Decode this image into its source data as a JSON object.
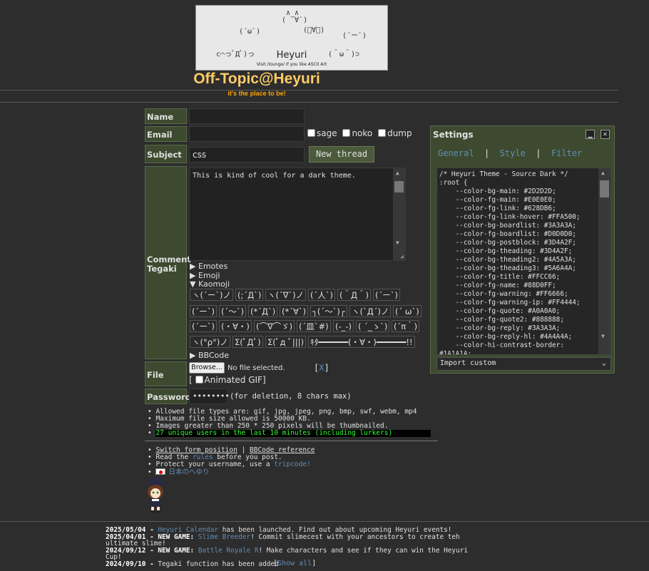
{
  "banner": {
    "title": "Heyuri",
    "subtitle": "Visit /lounge/ if you like ASCII Art"
  },
  "board": {
    "title": "Off-Topic@Heyuri",
    "subtitle": "it's the place to be!"
  },
  "form": {
    "name_label": "Name",
    "email_label": "Email",
    "subject_label": "Subject",
    "comment_label": "Comment",
    "tegaki_label": "Tegaki",
    "file_label": "File",
    "password_label": "Password",
    "subject_value": "css",
    "sage_label": "sage",
    "noko_label": "noko",
    "dump_label": "dump",
    "new_thread_button": "New thread",
    "comment_value": "This is kind of cool for a dark theme.",
    "emotes_label": "Emotes",
    "emoji_label": "Emoji",
    "kaomoji_label": "Kaomoji",
    "bbcode_label": "BBCode",
    "kaomoji": [
      [
        "ヽ(´ー`)ノ",
        "(;´Д`)",
        "ヽ(´∇`)ノ",
        "(´人`)",
        "(＾Д＾)",
        "(´ー`)"
      ],
      [
        "(´ー`)",
        "(´～`)",
        "(*´Д`)",
        "(*´∀`)",
        "┐(´～`)┌",
        "ヽ(`Д´)ノ",
        "(´ ω`)"
      ],
      [
        "(´ー`)",
        "(・∀・)",
        "(⌒∇⌒ゞ)",
        "(´皿`#)",
        "(-_-)",
        "( ´_ゝ`)",
        "(´π｀)"
      ],
      [
        "ヽ(°ρ°)ノ",
        "Σ(ﾟДﾟ)",
        "Σ(ﾟд ﾟ|||)",
        "ｷﾀ━━━━━━(・∀・)━━━━━━!!"
      ]
    ],
    "browse_button": "Browse...",
    "file_status": "No file selected.",
    "file_clear": "X",
    "animated_gif_label": "Animated GIF",
    "password_value": "••••••••",
    "password_hint": "(for deletion, 8 chars max)"
  },
  "rules": [
    "Allowed file types are: gif, jpg, jpeg, png, bmp, swf, webm, mp4",
    "Maximum file size allowed is 50000 KB.",
    "Images greater than 250 * 250 pixels will be thumbnailed."
  ],
  "users_online": "27 unique users in the last 10 minutes (including lurkers)",
  "links": {
    "switch_form": "Switch form position",
    "bbcode_ref": "BBCode reference",
    "rules_pre": "Read the ",
    "rules_link": "rules",
    "rules_post": " before you post.",
    "protect_pre": "Protect your username, use a ",
    "tripcode": "tripcode!",
    "japanese": "日本のへゆり"
  },
  "settings": {
    "title": "Settings",
    "tabs": [
      "General",
      "Style",
      "Filter"
    ],
    "code": [
      "/* Heyuri Theme - Source Dark */",
      ":root {",
      "    --color-bg-main: #2D2D2D;",
      "    --color-fg-main: #E0E0E0;",
      "    --color-fg-link: #628DB6;",
      "    --color-fg-link-hover: #FFA500;",
      "    --color-bg-boardlist: #3A3A3A;",
      "    --color-fg-boardlist: #D0D0D0;",
      "    --color-bg-postblock: #3D4A2F;",
      "    --color-bg-theading: #3D4A2F;",
      "    --color-bg-theading2: #4A5A3A;",
      "    --color-bg-theading3: #5A6A4A;",
      "    --color-fg-title: #FFCC66;",
      "    --color-fg-name: #88D0FF;",
      "    --color-fg-warning: #FF6666;",
      "    --color-fg-warning-ip: #FF4444;",
      "    --color-fg-quote: #A0A0A0;",
      "    --color-fg-quote2: #888888;",
      "    --color-bg-reply: #3A3A3A;",
      "    --color-bg-reply-hl: #4A4A4A;",
      "    --color-hi-contrast-border:",
      "#1A1A1A;"
    ],
    "import_label": "Import custom"
  },
  "news": [
    {
      "date": "2025/05/04",
      "prefix": "",
      "link": "Heyuri Calendar",
      "text": " has been launched. Find out about upcoming Heyuri events!"
    },
    {
      "date": "2025/04/01",
      "prefix": "NEW GAME: ",
      "link": "Slime Breeder",
      "text": "! Commit slimecest with your ancestors to create teh ultimate slime!"
    },
    {
      "date": "2024/09/12",
      "prefix": "NEW GAME: ",
      "link": "Battle Royale R",
      "text": "! Make characters and see if they can win the Heyuri Cup!"
    },
    {
      "date": "2024/09/10",
      "prefix": "",
      "link": "",
      "text": "Tegaki function has been added"
    }
  ],
  "show_all": "Show all",
  "colors": {
    "bg": "#2D2D2D",
    "title": "#FFCC66",
    "postblock": "#3D4A2F",
    "link": "#628DB6",
    "online": "#33FF33"
  }
}
